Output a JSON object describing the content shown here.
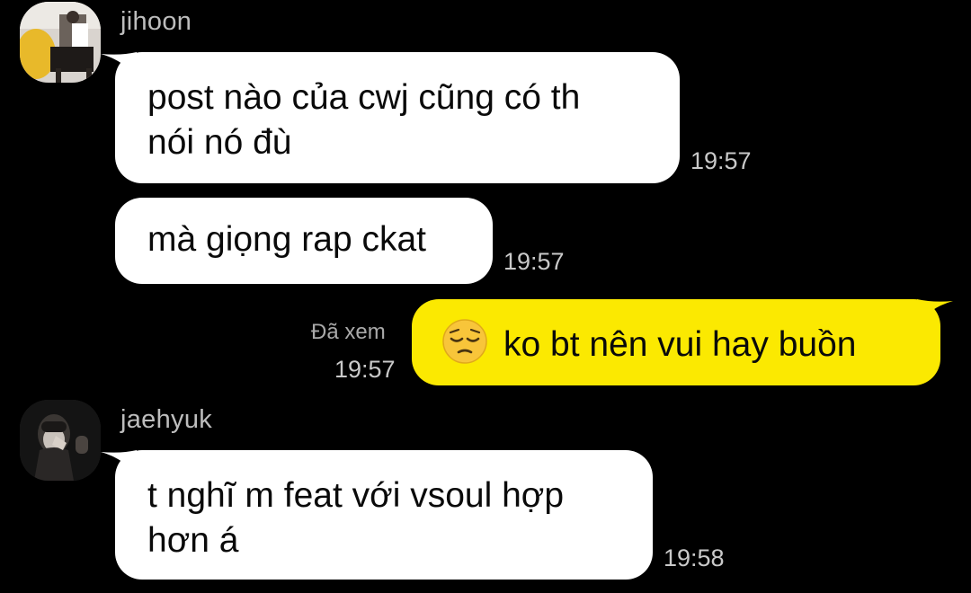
{
  "messages": [
    {
      "sender": "jihoon",
      "text_lines": [
        "post nào của cwj cũng có th",
        "nói nó đù"
      ],
      "time": "19:57"
    },
    {
      "sender": "jihoon",
      "text_lines": [
        "mà giọng rap ckat"
      ],
      "time": "19:57"
    },
    {
      "sender": "me",
      "emoji": "pensive-face-icon",
      "text": "ko bt nên vui hay buồn",
      "read_status": "Đã xem",
      "time": "19:57"
    },
    {
      "sender": "jaehyuk",
      "text_lines": [
        "t nghĩ m feat với vsoul hợp",
        "hơn á"
      ],
      "time": "19:58"
    }
  ],
  "colors": {
    "background": "#000000",
    "incoming_bubble": "#ffffff",
    "outgoing_bubble": "#fbe901",
    "meta_text": "#c9c9c9"
  }
}
